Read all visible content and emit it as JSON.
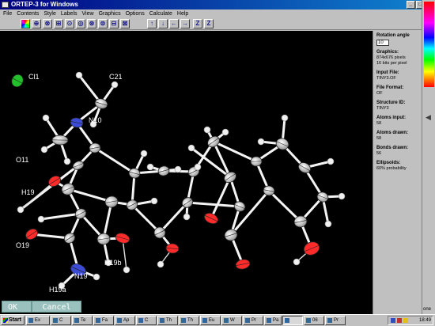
{
  "window": {
    "title": "ORTEP-3 for Windows"
  },
  "menu": [
    "File",
    "Contents",
    "Style",
    "Labels",
    "View",
    "Graphics",
    "Options",
    "Calculate",
    "Help"
  ],
  "toolbar": {
    "icons": [
      "color-wheel-icon",
      "atom-style-1-icon",
      "atom-style-2-icon",
      "atom-style-3-icon",
      "atom-style-4-icon",
      "atom-style-5-icon",
      "atom-style-6-icon",
      "atom-style-7-icon",
      "atom-style-8-icon",
      "atom-style-9-icon",
      "rotate-up-icon",
      "rotate-down-icon",
      "rotate-left-icon",
      "rotate-right-icon",
      "zoom-in-icon",
      "zoom-out-icon"
    ],
    "glyphs": [
      "",
      "⊕",
      "⊗",
      "⊞",
      "⊙",
      "◎",
      "⊛",
      "⊜",
      "⊟",
      "⊠",
      "↑",
      "↓",
      "←",
      "→",
      "Z",
      "Z"
    ]
  },
  "atom_labels": [
    {
      "id": "cl1",
      "text": "Cl1"
    },
    {
      "id": "c21",
      "text": "C21"
    },
    {
      "id": "n10",
      "text": "N10"
    },
    {
      "id": "o11",
      "text": "O11"
    },
    {
      "id": "h19",
      "text": "H19"
    },
    {
      "id": "o19",
      "text": "O19"
    },
    {
      "id": "h19b",
      "text": "H19b"
    },
    {
      "id": "n19",
      "text": "N19"
    },
    {
      "id": "h19a",
      "text": "H19a"
    }
  ],
  "dialog": {
    "ok_label": "OK",
    "cancel_label": "Cancel"
  },
  "panel": {
    "rotation_angle_label": "Rotation angle",
    "rotation_angle_value": "10",
    "graphics_label": "Graphics:",
    "graphics_value": "874x676 pixels",
    "graphics_value2": "16 bits per pixel",
    "input_file_label": "Input File:",
    "input_file_value": "TINY3.OF",
    "file_format_label": "File Format:",
    "file_format_value": "OF",
    "structure_id_label": "Structure ID:",
    "structure_id_value": "TINY3",
    "atoms_input_label": "Atoms input:",
    "atoms_input_value": "58",
    "atoms_drawn_label": "Atoms drawn:",
    "atoms_drawn_value": "58",
    "bonds_drawn_label": "Bonds drawn:",
    "bonds_drawn_value": "56",
    "ellipsoids_label": "Ellipsoids:",
    "ellipsoids_value": "60% probability"
  },
  "right_edge": {
    "bottom_label": "one"
  },
  "taskbar": {
    "start": "Start",
    "tasks": [
      "Ex",
      "C",
      "Te",
      "Fa",
      "Ap",
      "C",
      "Th",
      "Th",
      "Eu",
      "W",
      "Pr",
      "Pa",
      "",
      "06",
      "Pr"
    ],
    "clock": "18:49"
  },
  "colors": {
    "oxygen": "#ff2a2a",
    "nitrogen": "#3b4bd6",
    "chlorine": "#22c02a",
    "carbon": "#ffffff",
    "canvas": "#000000"
  }
}
